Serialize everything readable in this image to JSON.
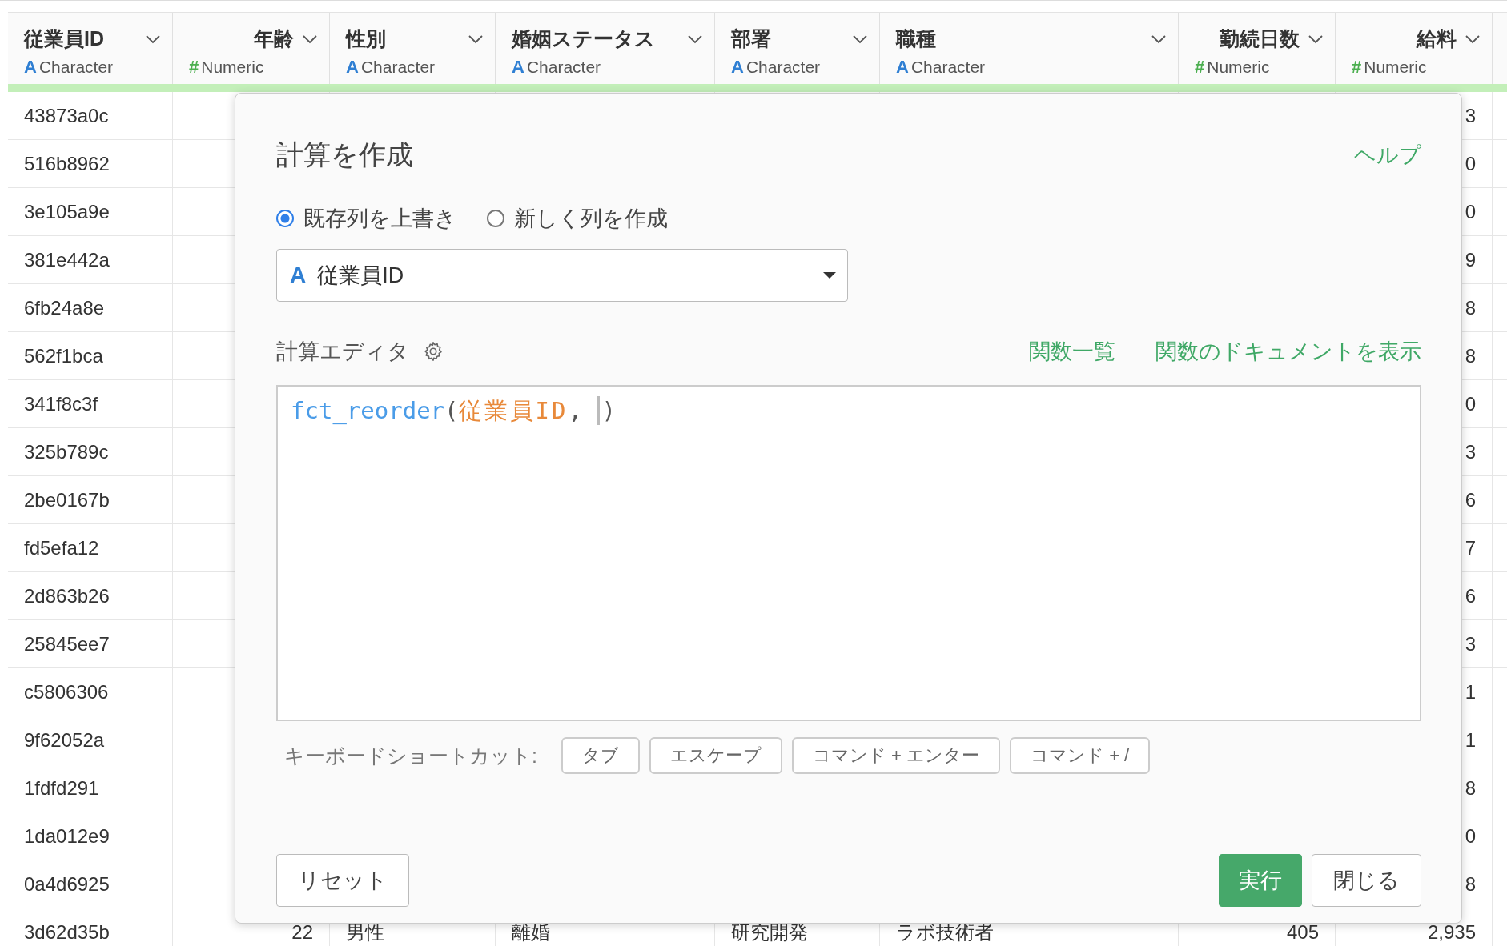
{
  "table": {
    "columns": [
      {
        "name": "従業員ID",
        "kind": "character",
        "icon": "A",
        "type": "Character"
      },
      {
        "name": "年齢",
        "kind": "numeric",
        "icon": "#",
        "type": "Numeric"
      },
      {
        "name": "性別",
        "kind": "character",
        "icon": "A",
        "type": "Character"
      },
      {
        "name": "婚姻ステータス",
        "kind": "character",
        "icon": "A",
        "type": "Character"
      },
      {
        "name": "部署",
        "kind": "character",
        "icon": "A",
        "type": "Character"
      },
      {
        "name": "職種",
        "kind": "character",
        "icon": "A",
        "type": "Character"
      },
      {
        "name": "勤続日数",
        "kind": "numeric",
        "icon": "#",
        "type": "Numeric"
      },
      {
        "name": "給料",
        "kind": "numeric",
        "icon": "#",
        "type": "Numeric"
      }
    ],
    "rows": [
      {
        "kind": "partial",
        "cells": [
          "43873a0c",
          "3"
        ]
      },
      {
        "kind": "partial",
        "cells": [
          "516b8962",
          "0"
        ]
      },
      {
        "kind": "partial",
        "cells": [
          "3e105a9e",
          "0"
        ]
      },
      {
        "kind": "partial",
        "cells": [
          "381e442a",
          "9"
        ]
      },
      {
        "kind": "partial",
        "cells": [
          "6fb24a8e",
          "8"
        ]
      },
      {
        "kind": "partial",
        "cells": [
          "562f1bca",
          "8"
        ]
      },
      {
        "kind": "partial",
        "cells": [
          "341f8c3f",
          "0"
        ]
      },
      {
        "kind": "partial",
        "cells": [
          "325b789c",
          "3"
        ]
      },
      {
        "kind": "partial",
        "cells": [
          "2be0167b",
          "6"
        ]
      },
      {
        "kind": "partial",
        "cells": [
          "fd5efa12",
          "7"
        ]
      },
      {
        "kind": "partial",
        "cells": [
          "2d863b26",
          "6"
        ]
      },
      {
        "kind": "partial",
        "cells": [
          "25845ee7",
          "3"
        ]
      },
      {
        "kind": "partial",
        "cells": [
          "c5806306",
          "1"
        ]
      },
      {
        "kind": "partial",
        "cells": [
          "9f62052a",
          "1"
        ]
      },
      {
        "kind": "partial",
        "cells": [
          "1fdfd291",
          "8"
        ]
      },
      {
        "kind": "partial",
        "cells": [
          "1da012e9",
          "0"
        ]
      },
      {
        "kind": "partial",
        "cells": [
          "0a4d6925",
          "8"
        ]
      },
      {
        "kind": "full",
        "cells": [
          "3d62d35b",
          "22",
          "男性",
          "離婚",
          "研究開発",
          "ラボ技術者",
          "405",
          "2,935"
        ]
      }
    ]
  },
  "dialog": {
    "title": "計算を作成",
    "help_link": "ヘルプ",
    "modes": [
      {
        "label": "既存列を上書き",
        "selected": true
      },
      {
        "label": "新しく列を作成",
        "selected": false
      }
    ],
    "column_select": {
      "icon": "A",
      "value": "従業員ID"
    },
    "editor_label": "計算エディタ",
    "links": [
      "関数一覧",
      "関数のドキュメントを表示"
    ],
    "editor": {
      "tokens": [
        {
          "kind": "function",
          "text": "fct_reorder"
        },
        {
          "kind": "punct",
          "text": "("
        },
        {
          "kind": "column",
          "text": "従業員ID"
        },
        {
          "kind": "punct",
          "text": ", "
        },
        {
          "kind": "cursor"
        },
        {
          "kind": "punct",
          "text": ")"
        }
      ]
    },
    "shortcuts_label": "キーボードショートカット:",
    "shortcuts": [
      "タブ",
      "エスケープ",
      "コマンド + エンター",
      "コマンド + /"
    ],
    "reset_button": "リセット",
    "run_button": "実行",
    "close_button": "閉じる"
  }
}
